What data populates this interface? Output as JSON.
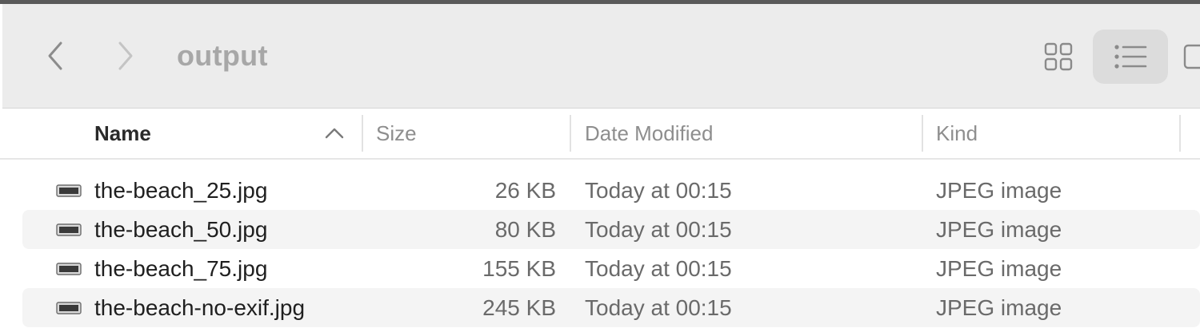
{
  "window": {
    "folder_title": "output"
  },
  "toolbar": {
    "back_icon": "chevron-left-icon",
    "forward_icon": "chevron-right-icon",
    "views": [
      "icon-view-icon",
      "list-view-icon",
      "column-view-icon"
    ],
    "active_view": "list"
  },
  "columns": {
    "name": "Name",
    "size": "Size",
    "date": "Date Modified",
    "kind": "Kind",
    "sort_column": "name",
    "sort_direction": "ascending"
  },
  "files": [
    {
      "name": "the-beach_25.jpg",
      "size": "26 KB",
      "date": "Today at 00:15",
      "kind": "JPEG image"
    },
    {
      "name": "the-beach_50.jpg",
      "size": "80 KB",
      "date": "Today at 00:15",
      "kind": "JPEG image"
    },
    {
      "name": "the-beach_75.jpg",
      "size": "155 KB",
      "date": "Today at 00:15",
      "kind": "JPEG image"
    },
    {
      "name": "the-beach-no-exif.jpg",
      "size": "245 KB",
      "date": "Today at 00:15",
      "kind": "JPEG image"
    }
  ],
  "colors": {
    "toolbar_bg": "#ececec",
    "selected_view_bg": "#dcdcdc",
    "alt_row_bg": "#f4f4f4",
    "title_text": "#a7a7a7"
  }
}
